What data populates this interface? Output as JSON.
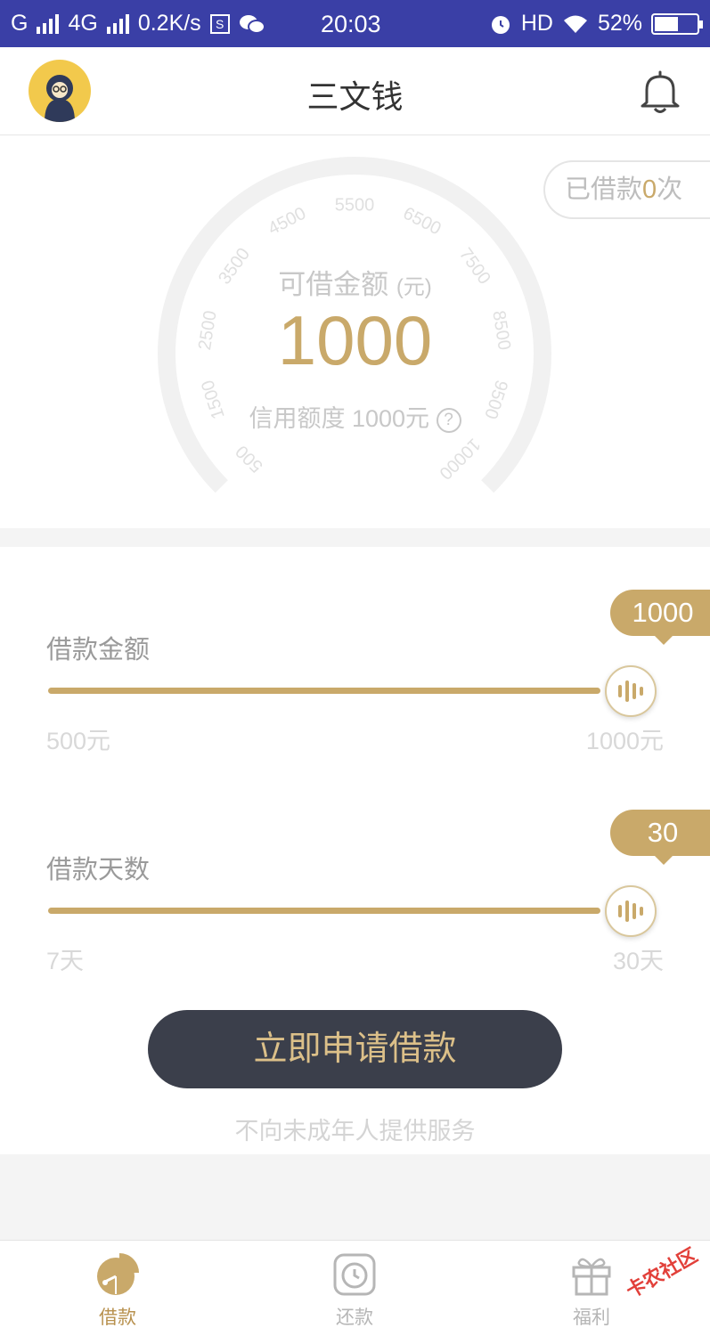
{
  "status_bar": {
    "carrier1": "G",
    "carrier2": "4G",
    "speed": "0.2K/s",
    "sim_label": "S",
    "time": "20:03",
    "hd": "HD",
    "battery": "52%"
  },
  "header": {
    "title": "三文钱"
  },
  "gauge": {
    "borrowed_prefix": "已借款",
    "borrowed_count": "0",
    "borrowed_suffix": "次",
    "available_label": "可借金额",
    "available_unit": "(元)",
    "available_amount": "1000",
    "credit_line": "信用额度 1000元",
    "help_glyph": "?",
    "ticks": [
      "500",
      "1500",
      "2500",
      "3500",
      "4500",
      "5500",
      "6500",
      "7500",
      "8500",
      "9500",
      "10000"
    ]
  },
  "sliders": {
    "amount": {
      "label": "借款金额",
      "value": "1000",
      "min_label": "500元",
      "max_label": "1000元",
      "fraction": 1.0
    },
    "days": {
      "label": "借款天数",
      "value": "30",
      "min_label": "7天",
      "max_label": "30天",
      "fraction": 1.0
    }
  },
  "apply_button": "立即申请借款",
  "notice": "不向未成年人提供服务",
  "bottom_nav": [
    {
      "label": "借款",
      "icon": "loan-pie-icon",
      "active": true
    },
    {
      "label": "还款",
      "icon": "repay-clock-icon",
      "active": false
    },
    {
      "label": "福利",
      "icon": "gift-icon",
      "active": false
    }
  ],
  "watermark": "卡农社区",
  "colors": {
    "accent_gold": "#c9a96a",
    "button_dark": "#3b3f4b",
    "status_bar": "#3a3fa6"
  }
}
